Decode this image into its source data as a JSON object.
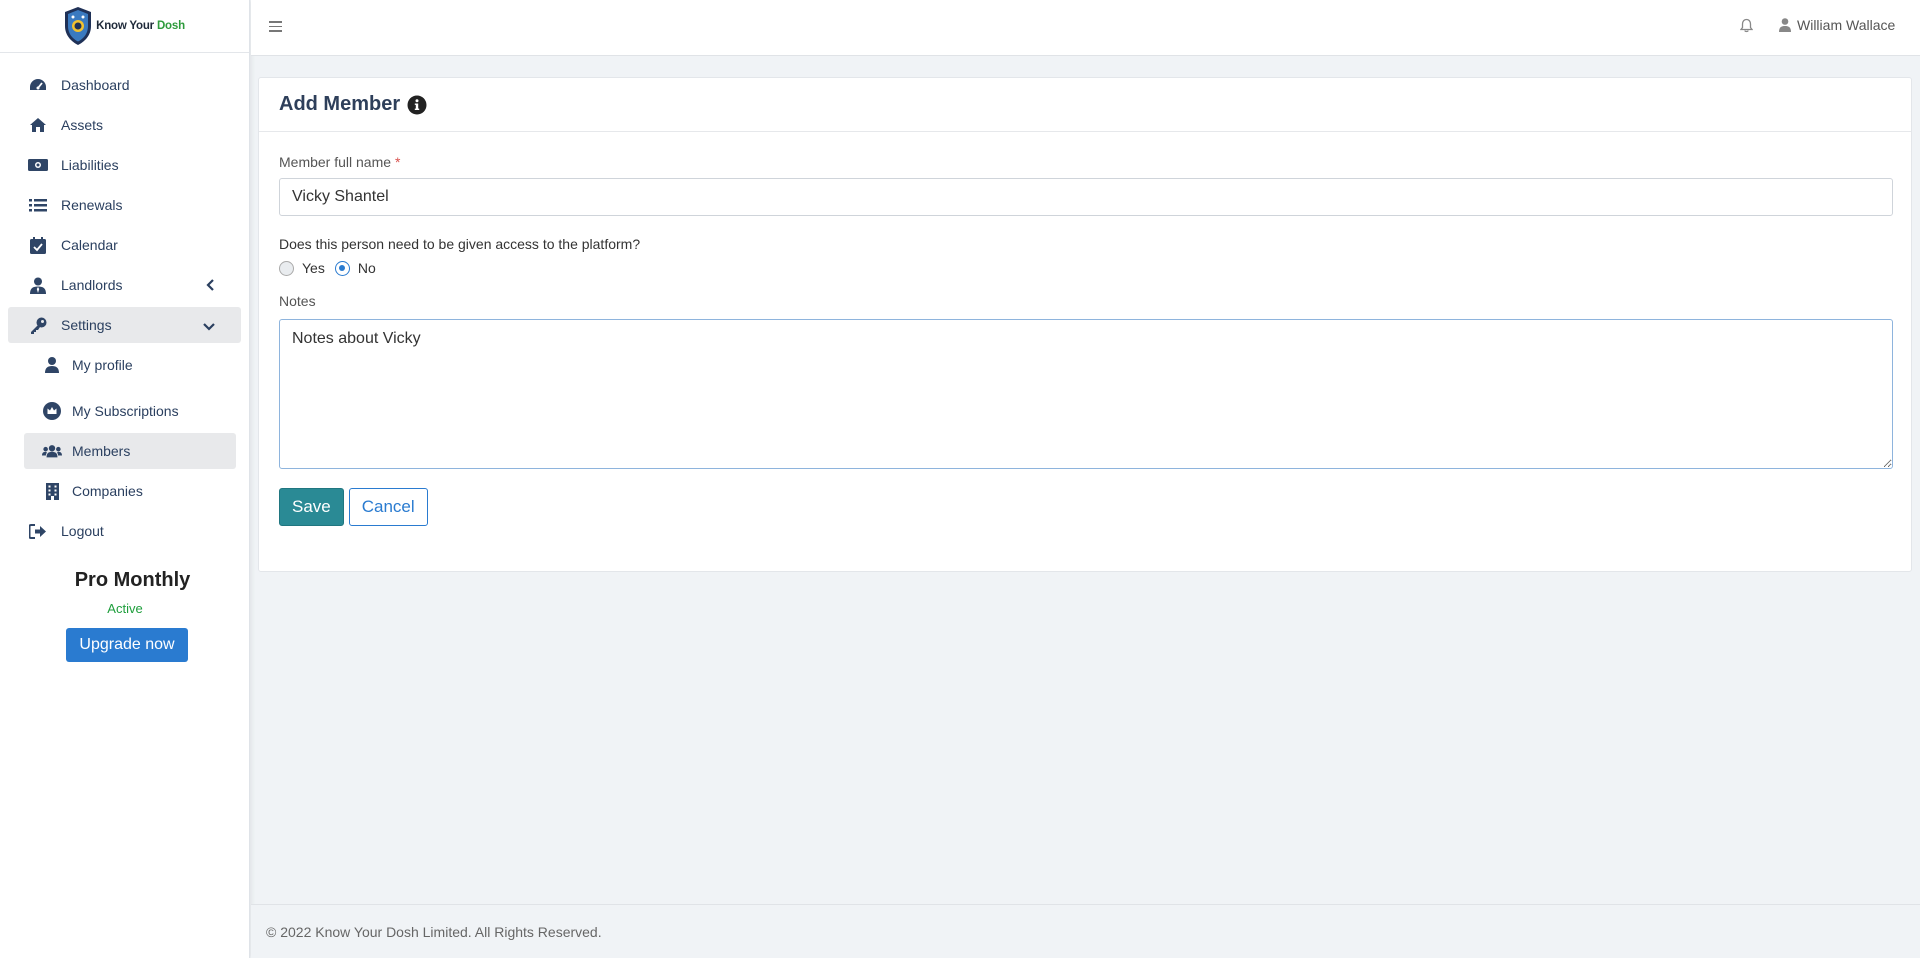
{
  "brand": {
    "name_part1": "Know Your",
    "name_part2": "Dosh"
  },
  "sidebar": {
    "items": [
      {
        "label": "Dashboard",
        "icon": "tachometer-icon"
      },
      {
        "label": "Assets",
        "icon": "home-icon"
      },
      {
        "label": "Liabilities",
        "icon": "money-bill-icon"
      },
      {
        "label": "Renewals",
        "icon": "list-icon"
      },
      {
        "label": "Calendar",
        "icon": "calendar-check-icon"
      },
      {
        "label": "Landlords",
        "icon": "user-tie-icon"
      },
      {
        "label": "Settings",
        "icon": "key-icon"
      }
    ],
    "sub_items": [
      {
        "label": "My profile",
        "icon": "user-icon"
      },
      {
        "label": "My Subscriptions",
        "icon": "crown-icon"
      },
      {
        "label": "Members",
        "icon": "users-icon"
      },
      {
        "label": "Companies",
        "icon": "building-icon"
      }
    ],
    "logout": {
      "label": "Logout",
      "icon": "sign-out-icon"
    }
  },
  "plan": {
    "name": "Pro Monthly",
    "status": "Active",
    "upgrade_label": "Upgrade now"
  },
  "topbar": {
    "user_name": "William Wallace"
  },
  "form": {
    "title": "Add Member",
    "name_label": "Member full name",
    "required_mark": "*",
    "name_value": "Vicky Shantel",
    "access_question": "Does this person need to be given access to the platform?",
    "option_yes": "Yes",
    "option_no": "No",
    "selected_option": "No",
    "notes_label": "Notes",
    "notes_value": "Notes about Vicky",
    "save_label": "Save",
    "cancel_label": "Cancel"
  },
  "footer": {
    "text": "© 2022 Know Your Dosh Limited. All Rights Reserved."
  },
  "colors": {
    "accent": "#2a7bd0",
    "save": "#2a8a95",
    "active_green": "#1e9e3c",
    "brand_green": "#2e9b3c"
  }
}
